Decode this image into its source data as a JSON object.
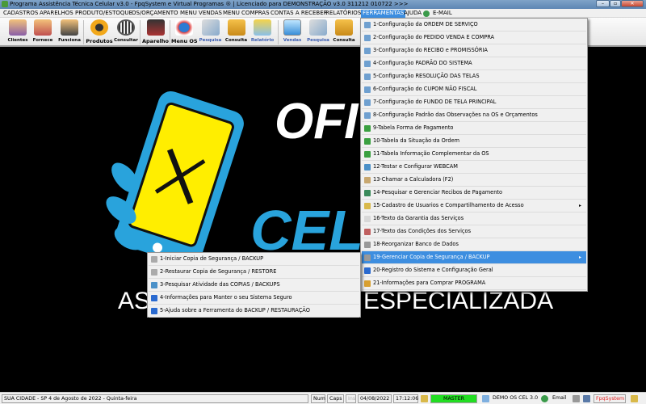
{
  "window": {
    "title": "Programa Assistência Técnica Celular v3.0 - FpqSystem e Virtual Programas ® | Licenciado para  DEMONSTRAÇÃO v3.0 311212 010722 >>>",
    "minimize": "–",
    "maximize": "▫",
    "close": "✕"
  },
  "menubar": [
    "CADASTROS",
    "APARELHOS",
    "PRODUTO/ESTOQUE",
    "OS/ORÇAMENTO",
    "MENU VENDAS",
    "MENU COMPRAS",
    "CONTAS A RECEBER",
    "RELATÓRIOS",
    "FERRAMENTAS",
    "AJUDA",
    "E-MAIL"
  ],
  "toolbar": [
    "Clientes",
    "Fornece",
    "Funciona",
    "Produtos",
    "Consultar",
    "Aparelho",
    "Menu OS",
    "Pesquisa",
    "Consulta",
    "Relatório",
    "Vendas",
    "Pesquisa",
    "Consulta"
  ],
  "background": {
    "line1": "OFI",
    "line2": "CEL",
    "line3a": "AS",
    "line3b": "ESPECIALIZADA"
  },
  "ferramentas_menu": [
    "1-Configuração da ORDEM DE SERVIÇO",
    "2-Configuração do PEDIDO VENDA E COMPRA",
    "3-Configuração do RECIBO e PROMISSÓRIA",
    "4-Configuração PADRÃO DO SISTEMA",
    "5-Configuração RESOLUÇÃO DAS TELAS",
    "6-Configuração do CUPOM NÃO FISCAL",
    "7-Configuração do FUNDO DE TELA PRINCIPAL",
    "8-Configuração Padrão das Observações na OS e Orçamentos",
    "9-Tabela Forma de Pagamento",
    "10-Tabela da Situação da Ordem",
    "11-Tabela Informação Complementar da OS",
    "12-Testar e Configurar WEBCAM",
    "13-Chamar a Calculadora (F2)",
    "14-Pesquisar e Gerenciar Recibos de Pagamento",
    "15-Cadastro de Usuarios e Compartilhamento de Acesso",
    "16-Texto da Garantia das Serviços",
    "17-Texto das Condições dos Serviços",
    "18-Reorganizar Banco de Dados",
    "19-Gerenciar Copia de Segurança / BACKUP",
    "20-Registro do Sistema e Configuração Geral",
    "21-Informações para Comprar PROGRAMA"
  ],
  "backup_submenu": [
    "1-Iniciar Copia de Segurança / BACKUP",
    "2-Restaurar Copia de Segurança / RESTORE",
    "3-Pesquisar Atividade das COPIAS / BACKUPS",
    "4-Informações para Manter o seu Sistema Seguro",
    "5-Ajuda sobre a Ferramenta do BACKUP / RESTAURAÇÃO"
  ],
  "submenu_arrow": "▸",
  "statusbar": {
    "location": "SUA CIDADE - SP  4 de Agosto de 2022 - Quinta-feira",
    "num": "Num",
    "caps": "Caps",
    "ins": "Ins",
    "date": "04/08/2022",
    "time": "17:12:06",
    "user": "MASTER",
    "db": "DEMO OS CEL 3.0",
    "email": "Email",
    "brand": "FpqSystem"
  },
  "colors": {
    "menu_highlight": "#3d8ee0",
    "master_bg": "#22dd22",
    "brand_text": "#e02020",
    "logo_blue": "#29a3dc",
    "logo_yellow": "#ffee00"
  }
}
